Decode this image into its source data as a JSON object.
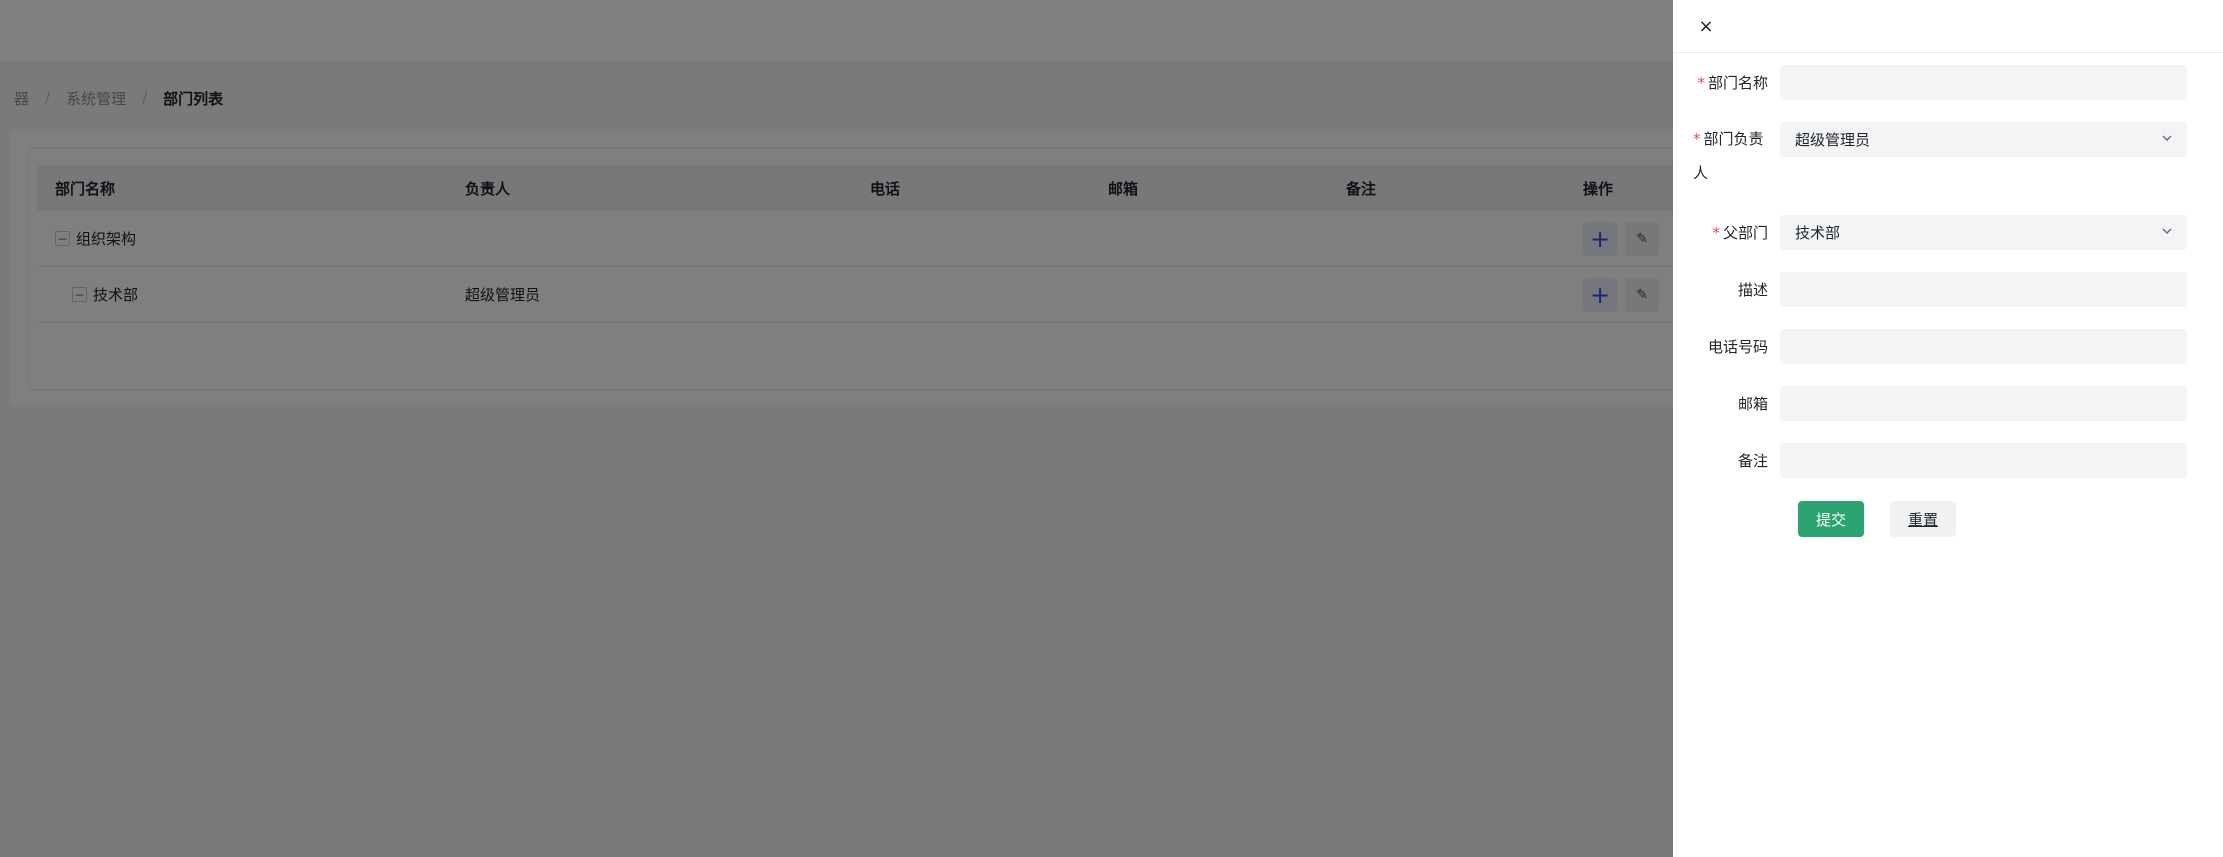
{
  "breadcrumb": {
    "home": "器",
    "section": "系统管理",
    "current": "部门列表",
    "separator": "/"
  },
  "table": {
    "headers": [
      "部门名称",
      "负责人",
      "电话",
      "邮箱",
      "备注",
      "操作"
    ],
    "rows": [
      {
        "name": "组织架构",
        "owner": "",
        "phone": "",
        "email": "",
        "note": "",
        "expander": "−"
      },
      {
        "name": "技术部",
        "owner": "超级管理员",
        "phone": "",
        "email": "",
        "note": "",
        "expander": "−"
      }
    ],
    "add_icon": "+"
  },
  "drawer": {
    "close": "×",
    "fields": {
      "dept_name": {
        "label": "部门名称",
        "required": "*",
        "value": ""
      },
      "dept_owner": {
        "label_line1": "部门负责",
        "label_line2": "人",
        "required": "*",
        "value": "超级管理员"
      },
      "parent_dept": {
        "label": "父部门",
        "required": "*",
        "value": "技术部"
      },
      "description": {
        "label": "描述",
        "value": ""
      },
      "phone": {
        "label": "电话号码",
        "value": ""
      },
      "email": {
        "label": "邮箱",
        "value": ""
      },
      "remark": {
        "label": "备注",
        "value": ""
      }
    },
    "submit_label": "提交",
    "reset_label": "重置"
  },
  "colors": {
    "primary_green": "#2ba471",
    "required_red": "#e34d59",
    "overlay": "rgba(0,0,0,0.5)"
  }
}
